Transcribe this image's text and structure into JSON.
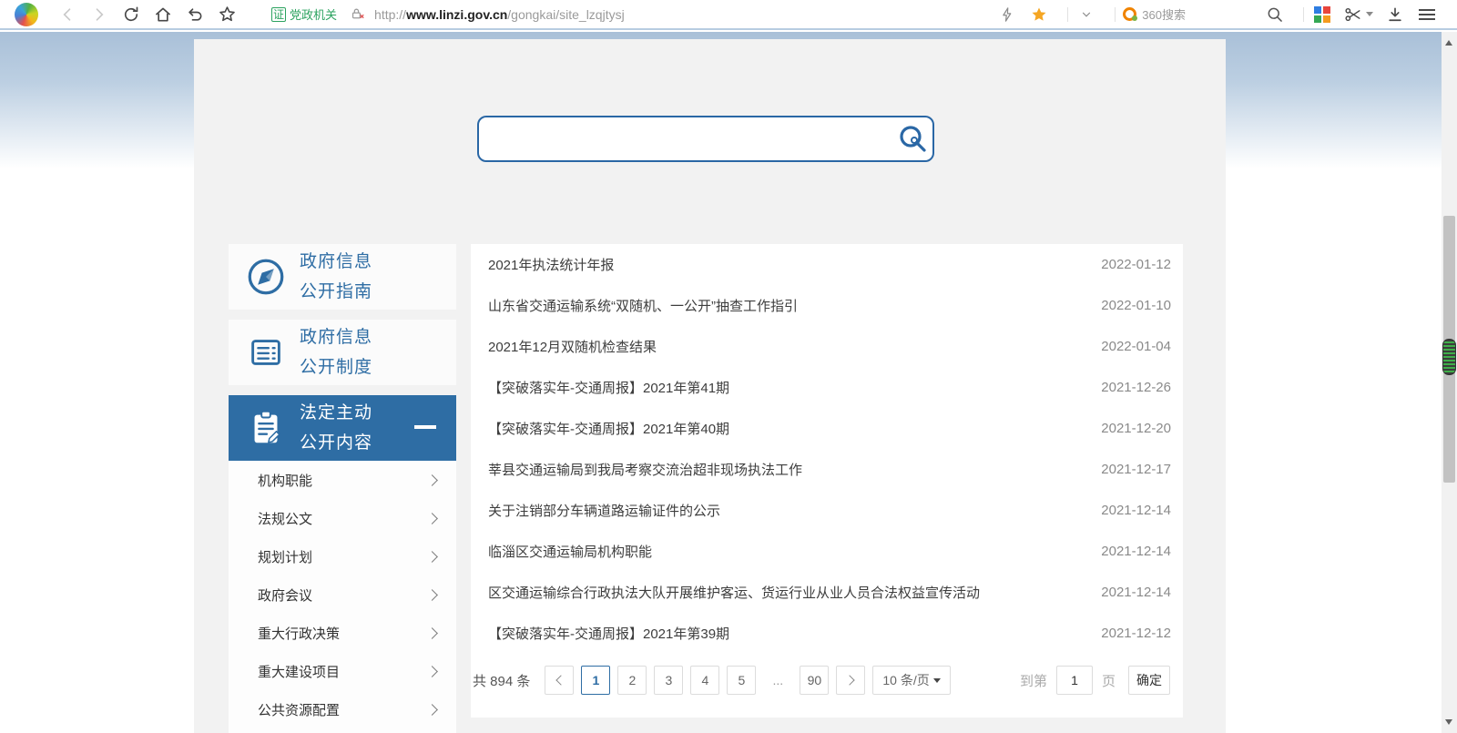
{
  "browser": {
    "badge_cert": "证",
    "badge_label": "党政机关",
    "url_scheme": "http://",
    "url_host": "www.linzi.gov.cn",
    "url_path": "/gongkai/site_lzqjtysj",
    "search_engine_label": "360搜索",
    "toolbar_icons": [
      "browser-logo",
      "back",
      "forward",
      "refresh",
      "home",
      "undo",
      "bookmark-star",
      "cert-badge",
      "insecure-lock",
      "flash",
      "favorite-star",
      "dropdown-caret",
      "360-search-logo",
      "find",
      "apps-grid",
      "screenshot-scissors",
      "download",
      "menu-hamburger"
    ]
  },
  "page": {
    "search": {
      "value": "",
      "placeholder": ""
    },
    "sidebar": {
      "groups": [
        {
          "line1": "政府信息",
          "line2": "公开指南",
          "icon": "compass",
          "active": false
        },
        {
          "line1": "政府信息",
          "line2": "公开制度",
          "icon": "document-lines",
          "active": false
        },
        {
          "line1": "法定主动",
          "line2": "公开内容",
          "icon": "clipboard-pen",
          "active": true
        }
      ],
      "items": [
        "机构职能",
        "法规公文",
        "规划计划",
        "政府会议",
        "重大行政决策",
        "重大建设项目",
        "公共资源配置"
      ]
    },
    "list": [
      {
        "title": "2021年执法统计年报",
        "date": "2022-01-12"
      },
      {
        "title": "山东省交通运输系统“双随机、一公开”抽查工作指引",
        "date": "2022-01-10"
      },
      {
        "title": "2021年12月双随机检查结果",
        "date": "2022-01-04"
      },
      {
        "title": "【突破落实年-交通周报】2021年第41期",
        "date": "2021-12-26"
      },
      {
        "title": "【突破落实年-交通周报】2021年第40期",
        "date": "2021-12-20"
      },
      {
        "title": "莘县交通运输局到我局考察交流治超非现场执法工作",
        "date": "2021-12-17"
      },
      {
        "title": "关于注销部分车辆道路运输证件的公示",
        "date": "2021-12-14"
      },
      {
        "title": "临淄区交通运输局机构职能",
        "date": "2021-12-14"
      },
      {
        "title": "区交通运输综合行政执法大队开展维护客运、货运行业从业人员合法权益宣传活动",
        "date": "2021-12-14"
      },
      {
        "title": "【突破落实年-交通周报】2021年第39期",
        "date": "2021-12-12"
      }
    ],
    "pagination": {
      "total_label": "共 894 条",
      "pages": [
        "1",
        "2",
        "3",
        "4",
        "5",
        "...",
        "90"
      ],
      "active_page": "1",
      "page_size_label": "10 条/页",
      "goto_prefix": "到第",
      "goto_value": "1",
      "goto_suffix": "页",
      "confirm_label": "确定"
    },
    "colors": {
      "accent": "#2e6da4",
      "badge_green": "#2ba25f",
      "date_gray": "#8a8a8a",
      "content_bg": "#f2f2f2"
    }
  }
}
